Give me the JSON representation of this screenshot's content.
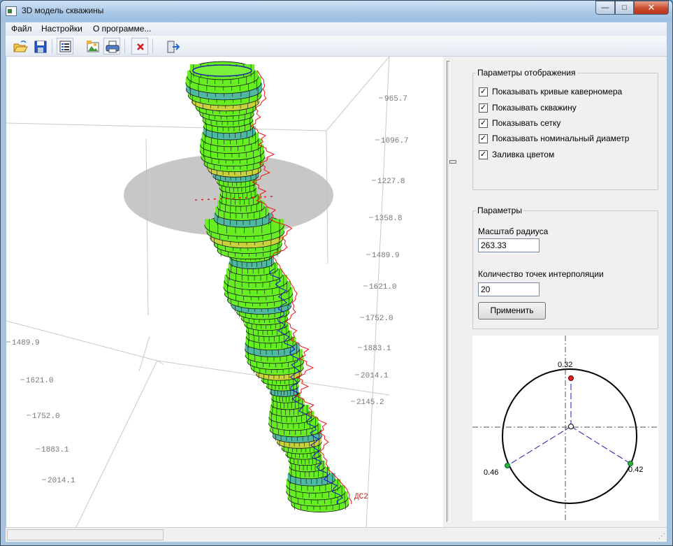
{
  "window": {
    "title": "3D модель скважины",
    "minimize_glyph": "—",
    "maximize_glyph": "□",
    "close_glyph": "✕"
  },
  "menu": {
    "file": "Файл",
    "settings": "Настройки",
    "about": "О программе..."
  },
  "toolbar": {
    "items": [
      "open-folder-icon",
      "save-icon",
      "list-icon",
      "image-icon",
      "print-icon",
      "delete-icon",
      "exit-icon"
    ]
  },
  "view3d": {
    "right_axis_labels": [
      "965.7",
      "1096.7",
      "1227.8",
      "1358.8",
      "1489.9",
      "1621.0",
      "1752.0",
      "1883.1",
      "2014.1",
      "2145.2"
    ],
    "left_axis_labels": [
      "1489.9",
      "1621.0",
      "1752.0",
      "1883.1",
      "2014.1"
    ],
    "curve_label": "ДС2",
    "colors": {
      "tube_fill": "#66ee22",
      "mesh": "#111111",
      "curve_red": "#ee1111",
      "curve_blue": "#1111cc",
      "plane": "#bdbdbd"
    }
  },
  "display_params": {
    "legend": "Параметры отображения",
    "options": [
      {
        "label": "Показывать кривые каверномера",
        "checked": true
      },
      {
        "label": "Показывать скважину",
        "checked": true
      },
      {
        "label": "Показывать сетку",
        "checked": true
      },
      {
        "label": "Показывать номинальный диаметр",
        "checked": true
      },
      {
        "label": "Заливка цветом",
        "checked": true
      }
    ],
    "check_glyph": "✓"
  },
  "params": {
    "legend": "Параметры",
    "radius_scale_label": "Масштаб радиуса",
    "radius_scale_value": "263.33",
    "interp_points_label": "Количество точек интерполяции",
    "interp_points_value": "20",
    "apply_label": "Применить"
  },
  "polar": {
    "top_value": "0.32",
    "left_value": "0.46",
    "right_value": "0.42"
  }
}
